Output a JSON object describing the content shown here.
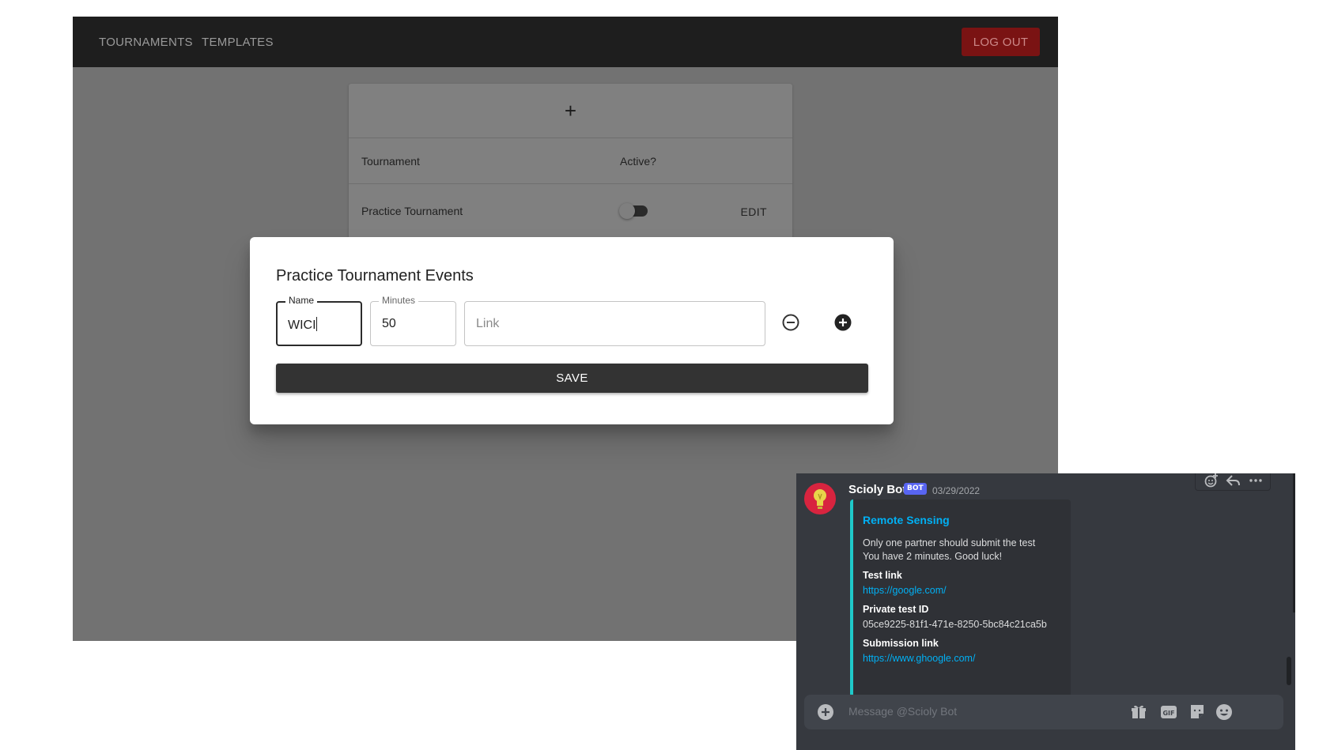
{
  "nav": {
    "links": [
      "TOURNAMENTS",
      "TEMPLATES"
    ],
    "logout_label": "LOG OUT"
  },
  "tournaments_table": {
    "add_symbol": "+",
    "columns": [
      "Tournament",
      "Active?"
    ],
    "rows": [
      {
        "name": "Practice Tournament",
        "active": false,
        "action": "EDIT"
      }
    ]
  },
  "dialog": {
    "title": "Practice Tournament Events",
    "fields": {
      "name": {
        "label": "Name",
        "value": "WICI"
      },
      "minutes": {
        "label": "Minutes",
        "value": "50"
      },
      "link": {
        "placeholder": "Link"
      }
    },
    "save_label": "SAVE"
  },
  "discord": {
    "author": "Scioly Bot",
    "badge": "BOT",
    "timestamp": "03/29/2022",
    "embed": {
      "color": "#1fc9c9",
      "title": "Remote Sensing",
      "description_lines": [
        "Only one partner should submit the test",
        "You have 2 minutes. Good luck!"
      ],
      "fields": [
        {
          "name": "Test link",
          "value": "https://google.com/",
          "is_link": true
        },
        {
          "name": "Private test ID",
          "value": "05ce9225-81f1-471e-8250-5bc84c21ca5b",
          "is_link": false
        },
        {
          "name": "Submission link",
          "value": "https://www.ghoogle.com/",
          "is_link": true
        }
      ]
    },
    "composer_placeholder": "Message @Scioly Bot",
    "composer_icons": [
      "add-attachment-icon",
      "gift-icon",
      "gif-icon",
      "sticker-icon",
      "emoji-icon"
    ],
    "gif_label": "GIF"
  }
}
